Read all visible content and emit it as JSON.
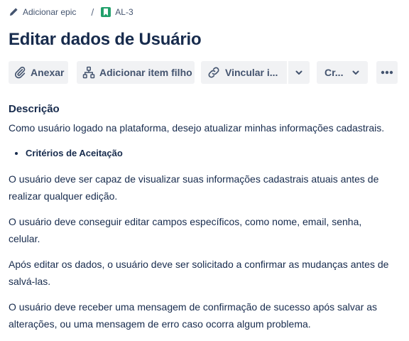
{
  "breadcrumb": {
    "epic_label": "Adicionar epic",
    "separator": "/",
    "issue_key": "AL-3"
  },
  "page_title": "Editar dados de Usuário",
  "toolbar": {
    "attach_label": "Anexar",
    "add_child_label": "Adicionar item filho",
    "link_label": "Vincular i...",
    "create_label": "Cr..."
  },
  "icons": {
    "edit": "pencil-icon",
    "issue": "story-icon",
    "attach": "paperclip-icon",
    "child": "hierarchy-icon",
    "link": "link-icon",
    "dropdown": "chevron-down-icon",
    "more": "more-horizontal-icon"
  },
  "colors": {
    "text": "#172b4d",
    "button_bg": "#f1f2f4",
    "story_green": "#22a06b"
  },
  "description": {
    "heading": "Descrição",
    "intro": "Como usuário logado na plataforma, desejo atualizar minhas informações cadastrais.",
    "bullet": "Critérios de Aceitação",
    "paragraphs": [
      "O usuário deve ser capaz de visualizar suas informações cadastrais atuais antes de realizar qualquer edição.",
      "O usuário deve conseguir editar campos específicos, como nome, email, senha, celular.",
      "Após editar os dados, o usuário deve ser solicitado a confirmar as mudanças antes de salvá-las.",
      "O usuário deve receber uma mensagem de confirmação de sucesso após salvar as alterações, ou uma mensagem de erro caso ocorra algum problema."
    ]
  }
}
